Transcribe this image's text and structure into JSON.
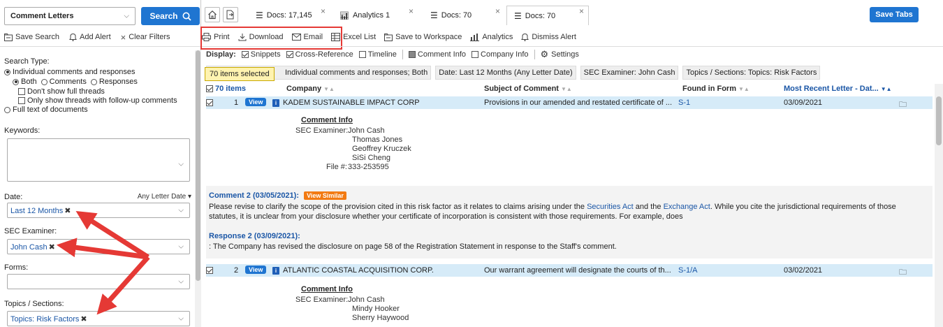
{
  "search": {
    "collection": "Comment Letters",
    "button_label": "Search"
  },
  "sidebar_toolbar": {
    "save_search": "Save Search",
    "add_alert": "Add Alert",
    "clear_filters": "Clear Filters"
  },
  "search_type": {
    "label": "Search Type:",
    "options": {
      "individual": "Individual comments and responses",
      "both": "Both",
      "comments": "Comments",
      "responses": "Responses",
      "dont_show_threads": "Don't show full threads",
      "only_followup": "Only show threads with follow-up comments",
      "full_text": "Full text of documents"
    }
  },
  "keywords": {
    "label": "Keywords:"
  },
  "date": {
    "label": "Date:",
    "mode": "Any Letter Date",
    "value": "Last 12 Months"
  },
  "examiner": {
    "label": "SEC Examiner:",
    "value": "John Cash"
  },
  "forms": {
    "label": "Forms:"
  },
  "topics": {
    "label": "Topics / Sections:",
    "value": "Topics: Risk Factors"
  },
  "tabs": [
    {
      "label": "Docs: 17,145"
    },
    {
      "label": "Analytics 1"
    },
    {
      "label": "Docs: 70"
    },
    {
      "label": "Docs: 70"
    }
  ],
  "save_tabs": "Save Tabs",
  "main_toolbar": {
    "print": "Print",
    "download": "Download",
    "email": "Email",
    "excel": "Excel List",
    "save_workspace": "Save to Workspace",
    "analytics": "Analytics",
    "dismiss": "Dismiss Alert"
  },
  "display": {
    "label": "Display:",
    "snippets": "Snippets",
    "cross_reference": "Cross-Reference",
    "timeline": "Timeline",
    "comment_info": "Comment Info",
    "company_info": "Company Info",
    "settings": "Settings"
  },
  "filters": {
    "selected_badge": "70 items selected",
    "chip1": "Individual comments and responses; Both",
    "chip2": "Date: Last 12 Months (Any Letter Date)",
    "chip3": "SEC Examiner: John Cash",
    "chip4": "Topics / Sections: Topics: Risk Factors"
  },
  "grid": {
    "count": "70 items",
    "col_company": "Company",
    "col_subject": "Subject of Comment",
    "col_form": "Found in Form",
    "col_date": "Most Recent Letter - Dat..."
  },
  "rows": [
    {
      "num": "1",
      "view": "View",
      "company": "KADEM SUSTAINABLE IMPACT CORP",
      "subject": "Provisions in our amended and restated certificate of ...",
      "form": "S-1",
      "date": "03/09/2021",
      "info": {
        "title": "Comment Info",
        "examiner_label": "SEC Examiner:",
        "examiners": [
          "John Cash",
          "Thomas Jones",
          "Geoffrey Kruczek",
          "SiSi Cheng"
        ],
        "file_label": "File #:",
        "file": "333-253595"
      }
    },
    {
      "num": "2",
      "view": "View",
      "company": "ATLANTIC COASTAL ACQUISITION CORP.",
      "subject": "Our warrant agreement will designate the courts of th...",
      "form": "S-1/A",
      "date": "03/02/2021",
      "info": {
        "title": "Comment Info",
        "examiner_label": "SEC Examiner:",
        "examiners": [
          "John Cash",
          "Mindy Hooker",
          "Sherry Haywood"
        ]
      }
    }
  ],
  "comment": {
    "title": "Comment 2 (03/05/2021):",
    "view_similar": "View Similar",
    "text_a": "Please revise to clarify the scope of the provision cited in this risk factor as it relates to claims arising under the ",
    "link1": "Securities Act",
    "text_b": " and the ",
    "link2": "Exchange Act",
    "text_c": ". While you cite the jurisdictional requirements of those",
    "text_line2": "statutes, it is unclear from your disclosure whether your certificate of incorporation is consistent with those requirements. For example, does",
    "response_title": "Response 2 (03/09/2021):",
    "response_text": ": The Company has revised the disclosure on page 58 of the Registration Statement in response to the Staff's comment."
  },
  "colors": {
    "accent": "#1f75d1",
    "row_highlight": "#d6ebf8",
    "annotation_red": "#e53935",
    "view_similar": "#f27a12"
  }
}
